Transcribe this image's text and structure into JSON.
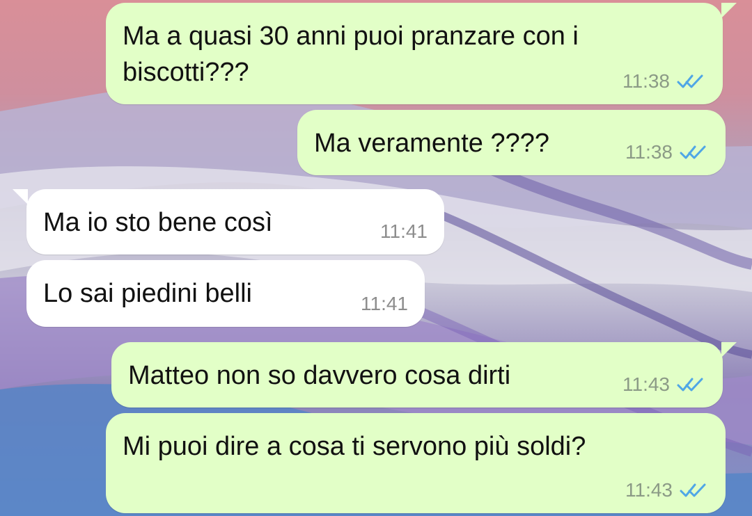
{
  "messages": [
    {
      "id": "m1",
      "direction": "outgoing",
      "text": "Ma a quasi 30 anni puoi pranzare con i\nbiscotti???",
      "time": "11:38",
      "status": "read"
    },
    {
      "id": "m2",
      "direction": "outgoing",
      "text": "Ma veramente ????",
      "time": "11:38",
      "status": "read"
    },
    {
      "id": "m3",
      "direction": "incoming",
      "text": "Ma io sto bene così",
      "time": "11:41"
    },
    {
      "id": "m4",
      "direction": "incoming",
      "text": "Lo sai piedini belli",
      "time": "11:41"
    },
    {
      "id": "m5",
      "direction": "outgoing",
      "text": "Matteo non so davvero cosa dirti",
      "time": "11:43",
      "status": "read"
    },
    {
      "id": "m6",
      "direction": "outgoing",
      "text": "Mi puoi dire a cosa ti servono più soldi?",
      "time": "11:43",
      "status": "read"
    }
  ],
  "colors": {
    "outgoing_bubble": "#e2ffc7",
    "incoming_bubble": "#ffffff",
    "read_ticks": "#4fa6e6",
    "timestamp": "#8b9a86"
  },
  "icons": {
    "read_status": "double-check-icon"
  }
}
